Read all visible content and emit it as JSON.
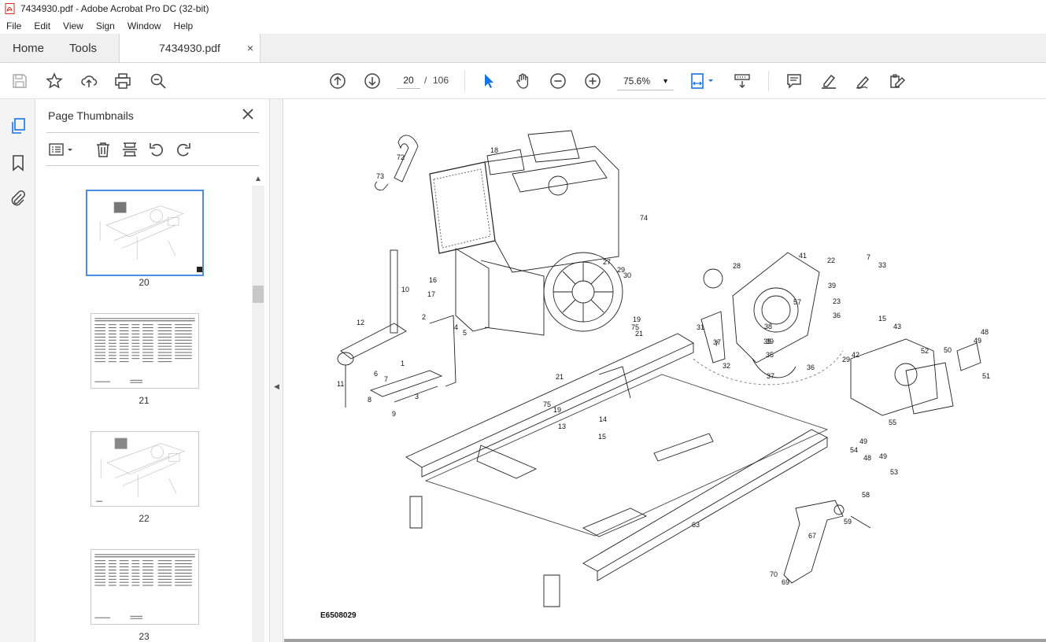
{
  "window": {
    "title": "7434930.pdf - Adobe Acrobat Pro DC (32-bit)"
  },
  "menu": [
    "File",
    "Edit",
    "View",
    "Sign",
    "Window",
    "Help"
  ],
  "tabs": {
    "home": "Home",
    "tools": "Tools",
    "document": "7434930.pdf",
    "close_glyph": "×"
  },
  "toolbar": {
    "current_page": "20",
    "separator": "/",
    "total_pages": "106",
    "zoom": "75.6%",
    "icons": [
      "save-icon",
      "bookmark-star-icon",
      "share-upload-icon",
      "print-icon",
      "search-zoom-icon",
      "page-up-icon",
      "page-down-icon",
      "select-cursor-icon",
      "hand-tool-icon",
      "zoom-out-icon",
      "zoom-in-icon",
      "fit-page-icon",
      "scroll-mode-icon",
      "comment-icon",
      "highlight-icon",
      "sign-icon",
      "edit-icon"
    ]
  },
  "thumbnail_panel": {
    "title": "Page Thumbnails",
    "pages": [
      {
        "label": "20",
        "kind": "diagram",
        "selected": true
      },
      {
        "label": "21",
        "kind": "parts-list",
        "selected": false
      },
      {
        "label": "22",
        "kind": "diagram",
        "selected": false
      },
      {
        "label": "23",
        "kind": "parts-list",
        "selected": false
      }
    ]
  },
  "document": {
    "drawing_id": "E6508029",
    "callouts": [
      "72",
      "73",
      "18",
      "74",
      "10",
      "16",
      "17",
      "12",
      "2",
      "4",
      "5",
      "1",
      "6",
      "7",
      "8",
      "11",
      "9",
      "3",
      "27",
      "29",
      "30",
      "19",
      "75",
      "21",
      "21",
      "75",
      "19",
      "14",
      "13",
      "15",
      "28",
      "41",
      "22",
      "7",
      "33",
      "39",
      "23",
      "57",
      "31",
      "38",
      "35",
      "36",
      "37",
      "7",
      "39",
      "32",
      "35",
      "36",
      "37",
      "15",
      "43",
      "48",
      "49",
      "50",
      "29",
      "42",
      "52",
      "51",
      "55",
      "49",
      "54",
      "48",
      "49",
      "53",
      "58",
      "59",
      "67",
      "70",
      "69",
      "63"
    ]
  },
  "colors": {
    "accent": "#1473e6",
    "selection": "#4a90e2",
    "pdf_red": "#d4291e"
  }
}
